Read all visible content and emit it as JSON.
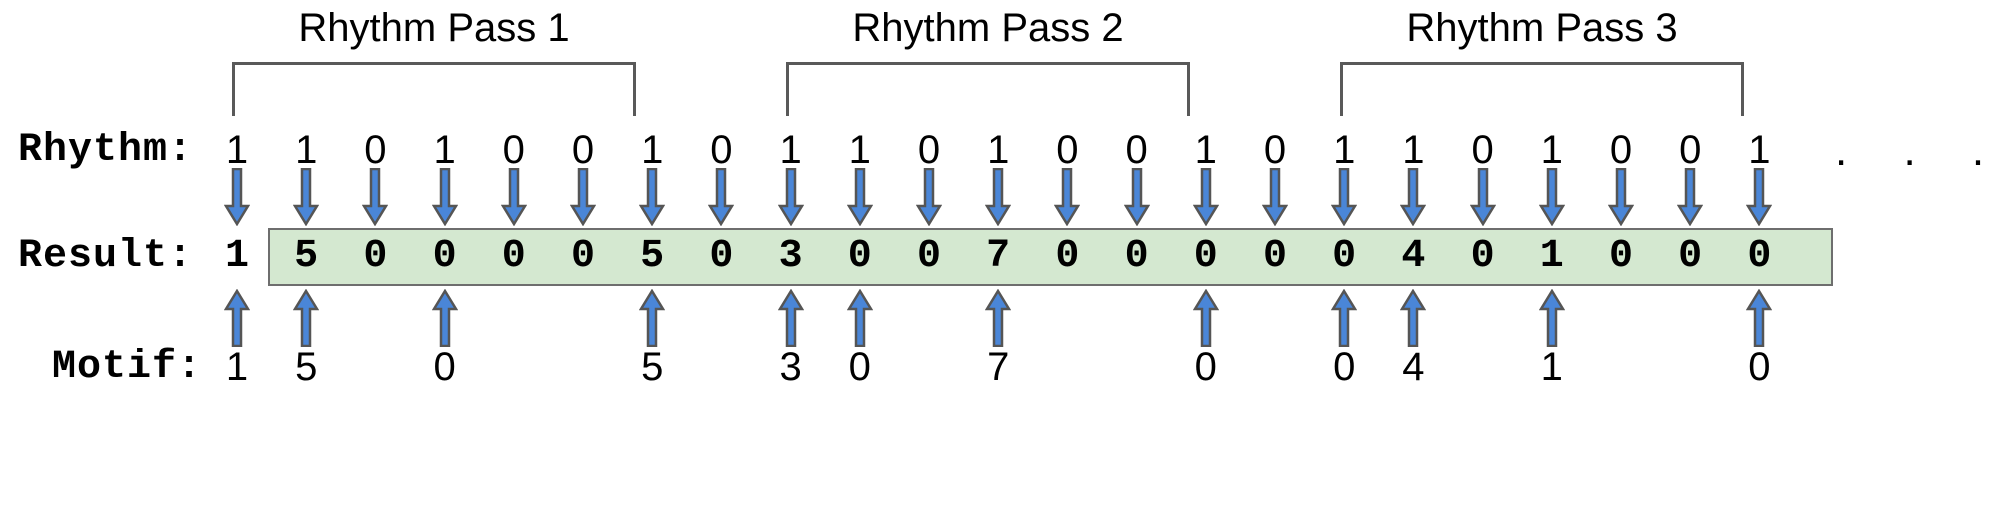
{
  "diagram": {
    "title_row_labels": {
      "rhythm": "Rhythm:",
      "result": "Result:",
      "motif": "Motif:"
    },
    "pass_labels": [
      "Rhythm Pass 1",
      "Rhythm Pass 2",
      "Rhythm Pass 3"
    ],
    "ellipsis": ". . .",
    "colors": {
      "result_band_fill": "#d4e8d0",
      "result_band_border": "#6e6e6e",
      "arrow_fill": "#4a86d8",
      "arrow_stroke": "#555555",
      "bracket_stroke": "#595959",
      "text": "#000000"
    },
    "rhythm": [
      "1",
      "1",
      "0",
      "1",
      "0",
      "0",
      "1",
      "0",
      "1",
      "1",
      "0",
      "1",
      "0",
      "0",
      "1",
      "0",
      "1",
      "1",
      "0",
      "1",
      "0",
      "0",
      "1"
    ],
    "result": [
      "1",
      "5",
      "0",
      "0",
      "0",
      "0",
      "5",
      "0",
      "3",
      "0",
      "0",
      "7",
      "0",
      "0",
      "0",
      "0",
      "0",
      "4",
      "0",
      "1",
      "0",
      "0",
      "0"
    ],
    "motif": [
      "1",
      "5",
      "",
      "0",
      "",
      "",
      "5",
      "",
      "3",
      "0",
      "",
      "7",
      "",
      "",
      "0",
      "",
      "0",
      "4",
      "",
      "1",
      "",
      "",
      "0"
    ],
    "down_arrow_columns": [
      0,
      1,
      2,
      3,
      4,
      5,
      6,
      7,
      8,
      9,
      10,
      11,
      12,
      13,
      14,
      15,
      16,
      17,
      18,
      19,
      20,
      21,
      22
    ],
    "up_arrow_columns": [
      0,
      1,
      3,
      6,
      8,
      9,
      11,
      14,
      16,
      17,
      19,
      22
    ]
  }
}
